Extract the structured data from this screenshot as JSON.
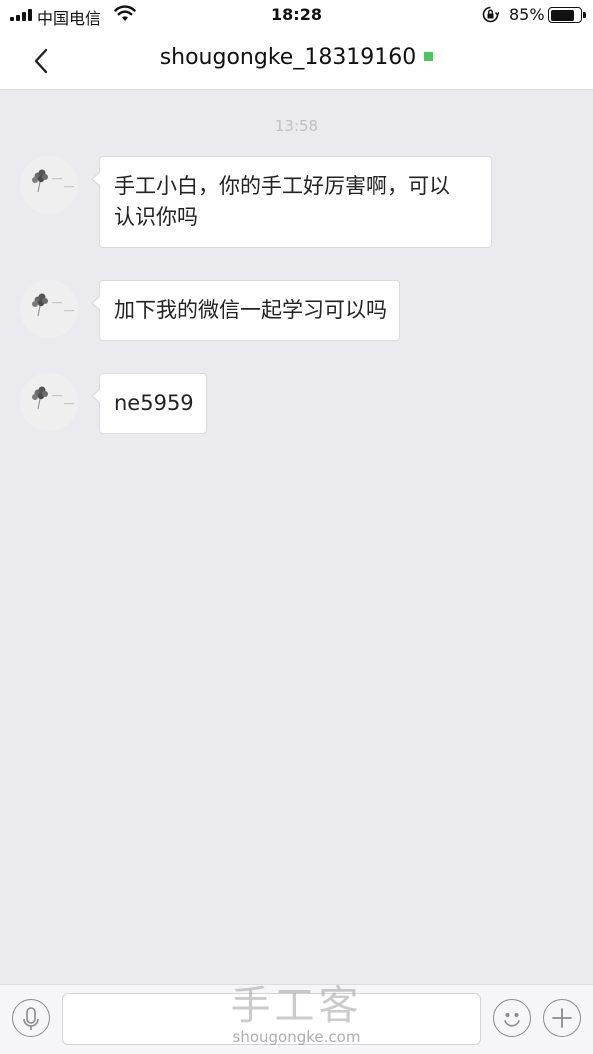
{
  "status_bar": {
    "carrier": "中国电信",
    "time": "18:28",
    "battery_percent": "85%",
    "battery_level": 0.85
  },
  "header": {
    "title": "shougongke_18319160",
    "online_color": "#49c95a"
  },
  "chat": {
    "timestamp": "13:58",
    "messages": [
      {
        "text": "手工小白，你的手工好厉害啊，可以认识你吗",
        "line1": "手工小白，你的手工好厉害啊，可以",
        "line2": "认识你吗"
      },
      {
        "text": "加下我的微信一起学习可以吗"
      },
      {
        "text": "ne5959"
      }
    ]
  },
  "input_bar": {
    "placeholder": "",
    "icons": [
      "microphone-icon",
      "emoji-icon",
      "plus-icon"
    ]
  },
  "watermark": {
    "brand_cn": "手工客",
    "brand_url": "shougongke.com"
  }
}
